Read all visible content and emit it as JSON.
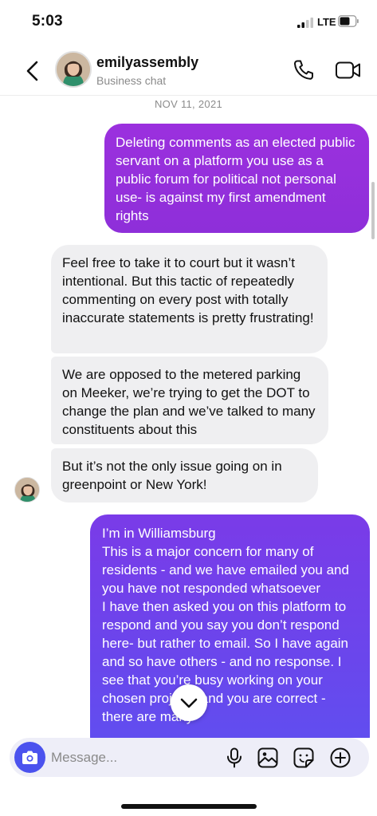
{
  "status_bar": {
    "time": "5:03",
    "network": "LTE",
    "icons": [
      "signal-icon",
      "battery-icon"
    ]
  },
  "header": {
    "contact_name": "emilyassembly",
    "subtitle": "Business chat",
    "icons": [
      "back-icon",
      "phone-icon",
      "video-icon"
    ]
  },
  "chat": {
    "date_label": "NOV 11, 2021",
    "messages": [
      {
        "direction": "outgoing",
        "color": "#9b30de",
        "text": "Deleting comments as an elected public servant on a platform you use as a public forum for political not personal use- is against my first amendment rights"
      },
      {
        "direction": "incoming",
        "color": "#efeff1",
        "text": "Feel free to take it to court but it wasn’t intentional. But this tactic of repeatedly commenting on every post with totally inaccurate statements is pretty frustrating!"
      },
      {
        "direction": "incoming",
        "color": "#efeff1",
        "text": "We are opposed to the metered parking on Meeker, we’re trying to get the DOT to change the plan and we’ve talked to many constituents about this"
      },
      {
        "direction": "incoming",
        "color": "#efeff1",
        "text": "But it’s not the only issue going on in greenpoint or New York!"
      },
      {
        "direction": "outgoing",
        "color": "#6a46ec",
        "text": "I’m in Williamsburg\nThis is a major concern for many of residents - and we have emailed you and you have not responded whatsoever\nI have then asked you on this platform to respond and you say you don’t respond here- but rather to email. So I have again and so have others - and no response. I see that you’re busy working on your chosen projects and you are correct - there are many"
      }
    ]
  },
  "composer": {
    "placeholder": "Message...",
    "icons": [
      "camera-icon",
      "microphone-icon",
      "gallery-icon",
      "sticker-icon",
      "add-icon"
    ],
    "accent": "#4b52ee"
  },
  "scroll_down_icon": "chevron-down-icon"
}
